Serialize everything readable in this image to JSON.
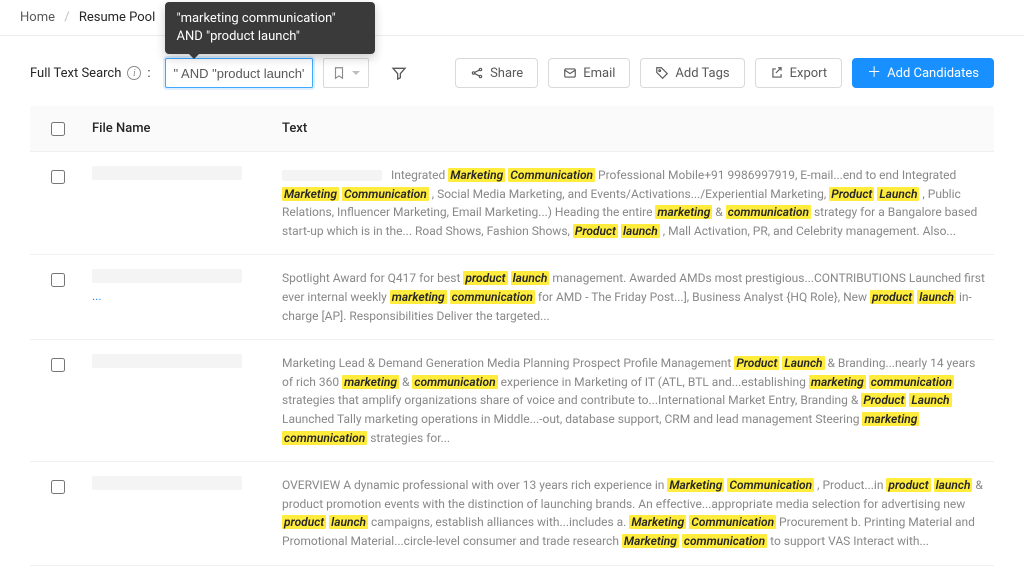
{
  "breadcrumb": {
    "home": "Home",
    "current": "Resume Pool"
  },
  "search": {
    "label": "Full Text Search",
    "label_suffix": ":",
    "value": "\" AND \"product launch\"",
    "tooltip": "\"marketing communication\" AND \"product launch\""
  },
  "actions": {
    "share": "Share",
    "email": "Email",
    "add_tags": "Add Tags",
    "export": "Export",
    "add_candidates": "Add Candidates"
  },
  "columns": {
    "file_name": "File Name",
    "text": "Text"
  },
  "rows": [
    {
      "ellips": "",
      "segments": [
        {
          "t": "redact"
        },
        {
          "t": "txt",
          "v": " Integrated "
        },
        {
          "t": "hl",
          "v": "Marketing"
        },
        {
          "t": "txt",
          "v": " "
        },
        {
          "t": "hl",
          "v": "Communication"
        },
        {
          "t": "txt",
          "v": " Professional Mobile+91 9986997919, E-mail...end to end Integrated "
        },
        {
          "t": "hl",
          "v": "Marketing"
        },
        {
          "t": "txt",
          "v": " "
        },
        {
          "t": "hl",
          "v": "Communication"
        },
        {
          "t": "txt",
          "v": " , Social Media Marketing, and Events/Activations.../Experiential Marketing, "
        },
        {
          "t": "hl",
          "v": "Product"
        },
        {
          "t": "txt",
          "v": " "
        },
        {
          "t": "hl",
          "v": "Launch"
        },
        {
          "t": "txt",
          "v": " , Public Relations, Influencer Marketing, Email Marketing...) Heading the entire "
        },
        {
          "t": "hl",
          "v": "marketing"
        },
        {
          "t": "txt",
          "v": " & "
        },
        {
          "t": "hl",
          "v": "communication"
        },
        {
          "t": "txt",
          "v": " strategy for a Bangalore based start-up which is in the... Road Shows, Fashion Shows, "
        },
        {
          "t": "hl",
          "v": "Product"
        },
        {
          "t": "txt",
          "v": " "
        },
        {
          "t": "hl",
          "v": "launch"
        },
        {
          "t": "txt",
          "v": " , Mall Activation, PR, and Celebrity management. Also..."
        }
      ]
    },
    {
      "ellips": "...",
      "segments": [
        {
          "t": "txt",
          "v": "Spotlight Award for Q417 for best "
        },
        {
          "t": "hl",
          "v": "product"
        },
        {
          "t": "txt",
          "v": " "
        },
        {
          "t": "hl",
          "v": "launch"
        },
        {
          "t": "txt",
          "v": " management. Awarded AMDs most prestigious...CONTRIBUTIONS Launched first ever internal weekly "
        },
        {
          "t": "hl",
          "v": "marketing"
        },
        {
          "t": "txt",
          "v": " "
        },
        {
          "t": "hl",
          "v": "communication"
        },
        {
          "t": "txt",
          "v": " for AMD - The Friday Post...], Business Analyst {HQ Role}, New "
        },
        {
          "t": "hl",
          "v": "product"
        },
        {
          "t": "txt",
          "v": " "
        },
        {
          "t": "hl",
          "v": "launch"
        },
        {
          "t": "txt",
          "v": " in-charge [AP]. Responsibilities Deliver the targeted..."
        }
      ]
    },
    {
      "ellips": "",
      "segments": [
        {
          "t": "txt",
          "v": "Marketing Lead & Demand Generation Media Planning Prospect Profile Management "
        },
        {
          "t": "hl",
          "v": "Product"
        },
        {
          "t": "txt",
          "v": " "
        },
        {
          "t": "hl",
          "v": "Launch"
        },
        {
          "t": "txt",
          "v": " & Branding...nearly 14 years of rich 360 "
        },
        {
          "t": "hl",
          "v": "marketing"
        },
        {
          "t": "txt",
          "v": " & "
        },
        {
          "t": "hl",
          "v": "communication"
        },
        {
          "t": "txt",
          "v": " experience in Marketing of IT (ATL, BTL and...establishing "
        },
        {
          "t": "hl",
          "v": "marketing"
        },
        {
          "t": "txt",
          "v": " "
        },
        {
          "t": "hl",
          "v": "communication"
        },
        {
          "t": "txt",
          "v": " strategies that amplify organizations share of voice and contribute to...International Market Entry, Branding & "
        },
        {
          "t": "hl",
          "v": "Product"
        },
        {
          "t": "txt",
          "v": " "
        },
        {
          "t": "hl",
          "v": "Launch"
        },
        {
          "t": "txt",
          "v": " Launched Tally marketing operations in Middle...-out, database support, CRM and lead management Steering "
        },
        {
          "t": "hl",
          "v": "marketing"
        },
        {
          "t": "txt",
          "v": " "
        },
        {
          "t": "hl",
          "v": "communication"
        },
        {
          "t": "txt",
          "v": " strategies for..."
        }
      ]
    },
    {
      "ellips": "",
      "segments": [
        {
          "t": "txt",
          "v": "OVERVIEW A dynamic professional with over 13 years rich experience in "
        },
        {
          "t": "hl",
          "v": "Marketing"
        },
        {
          "t": "txt",
          "v": " "
        },
        {
          "t": "hl",
          "v": "Communication"
        },
        {
          "t": "txt",
          "v": " , Product...in "
        },
        {
          "t": "hl",
          "v": "product"
        },
        {
          "t": "txt",
          "v": " "
        },
        {
          "t": "hl",
          "v": "launch"
        },
        {
          "t": "txt",
          "v": " & product promotion events with the distinction of launching brands. An effective...appropriate media selection for advertising new "
        },
        {
          "t": "hl",
          "v": "product"
        },
        {
          "t": "txt",
          "v": " "
        },
        {
          "t": "hl",
          "v": "launch"
        },
        {
          "t": "txt",
          "v": " campaigns, establish alliances with...includes a. "
        },
        {
          "t": "hl",
          "v": "Marketing"
        },
        {
          "t": "txt",
          "v": " "
        },
        {
          "t": "hl",
          "v": "Communication"
        },
        {
          "t": "txt",
          "v": " Procurement b. Printing Material and Promotional Material...circle-level consumer and trade research "
        },
        {
          "t": "hl",
          "v": "Marketing"
        },
        {
          "t": "txt",
          "v": " "
        },
        {
          "t": "hl",
          "v": "communication"
        },
        {
          "t": "txt",
          "v": " to support VAS Interact with..."
        }
      ]
    }
  ]
}
